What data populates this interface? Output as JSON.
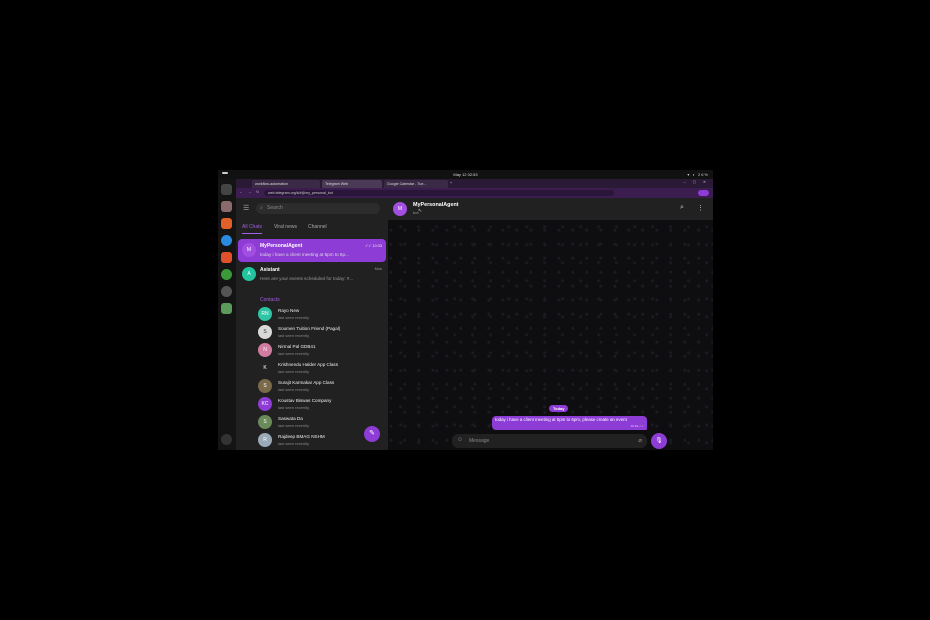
{
  "system": {
    "clock": "May 12 02:53",
    "battery": "26%"
  },
  "browser": {
    "tabs": [
      {
        "label": "workflow-automation"
      },
      {
        "label": "Telegram Web"
      },
      {
        "label": "Google Calendar - Tue..."
      }
    ],
    "url": "web.telegram.org/k/#@my_personal_bot"
  },
  "telegram": {
    "search_placeholder": "Search",
    "folders": [
      "All Chats",
      "Viral news",
      "Channel"
    ],
    "chats": [
      {
        "initial": "M",
        "name": "MyPersonalAgent",
        "message": "today i have a client meeting at 5pm to 6p...",
        "time": "✓✓ 10:33",
        "color": "#a24ee0"
      },
      {
        "initial": "A",
        "name": "Asistant",
        "message": "Here are your events scheduled for today: #...",
        "time": "Mon",
        "color": "#22c4a0"
      }
    ],
    "contacts_heading": "Contacts",
    "contacts": [
      {
        "initial": "RN",
        "name": "Rayo New",
        "status": "last seen recently",
        "color": "#2ec4a6"
      },
      {
        "initial": "S",
        "name": "Soumen Tuition Friend (Pagal)",
        "status": "last seen recently",
        "color": "#d8d8d8"
      },
      {
        "initial": "N",
        "name": "Nirmal Pal GDB41",
        "status": "last seen recently",
        "color": "#d07ba0"
      },
      {
        "initial": "K",
        "name": "Krishnendu Halder App Class",
        "status": "last seen recently",
        "color": "#222222"
      },
      {
        "initial": "S",
        "name": "Surajit Karmakar App Class",
        "status": "last seen recently",
        "color": "#7a6a4a"
      },
      {
        "initial": "KC",
        "name": "Koustav Biswas Company",
        "status": "last seen recently",
        "color": "#8d3cd6"
      },
      {
        "initial": "S",
        "name": "Saswata Da",
        "status": "last seen recently",
        "color": "#6a8a5a"
      },
      {
        "initial": "R",
        "name": "Rajdeep BMAG NSHM",
        "status": "last seen recently",
        "color": "#9aaab8"
      }
    ],
    "active_chat": {
      "initial": "M",
      "title": "MyPersonalAgent",
      "status": "bot"
    },
    "date_label": "Today",
    "message": {
      "text": "today i have a client meeting at 5pm to 6pm, please create an event",
      "time": "10:33 ✓✓"
    },
    "compose_placeholder": "Message"
  }
}
